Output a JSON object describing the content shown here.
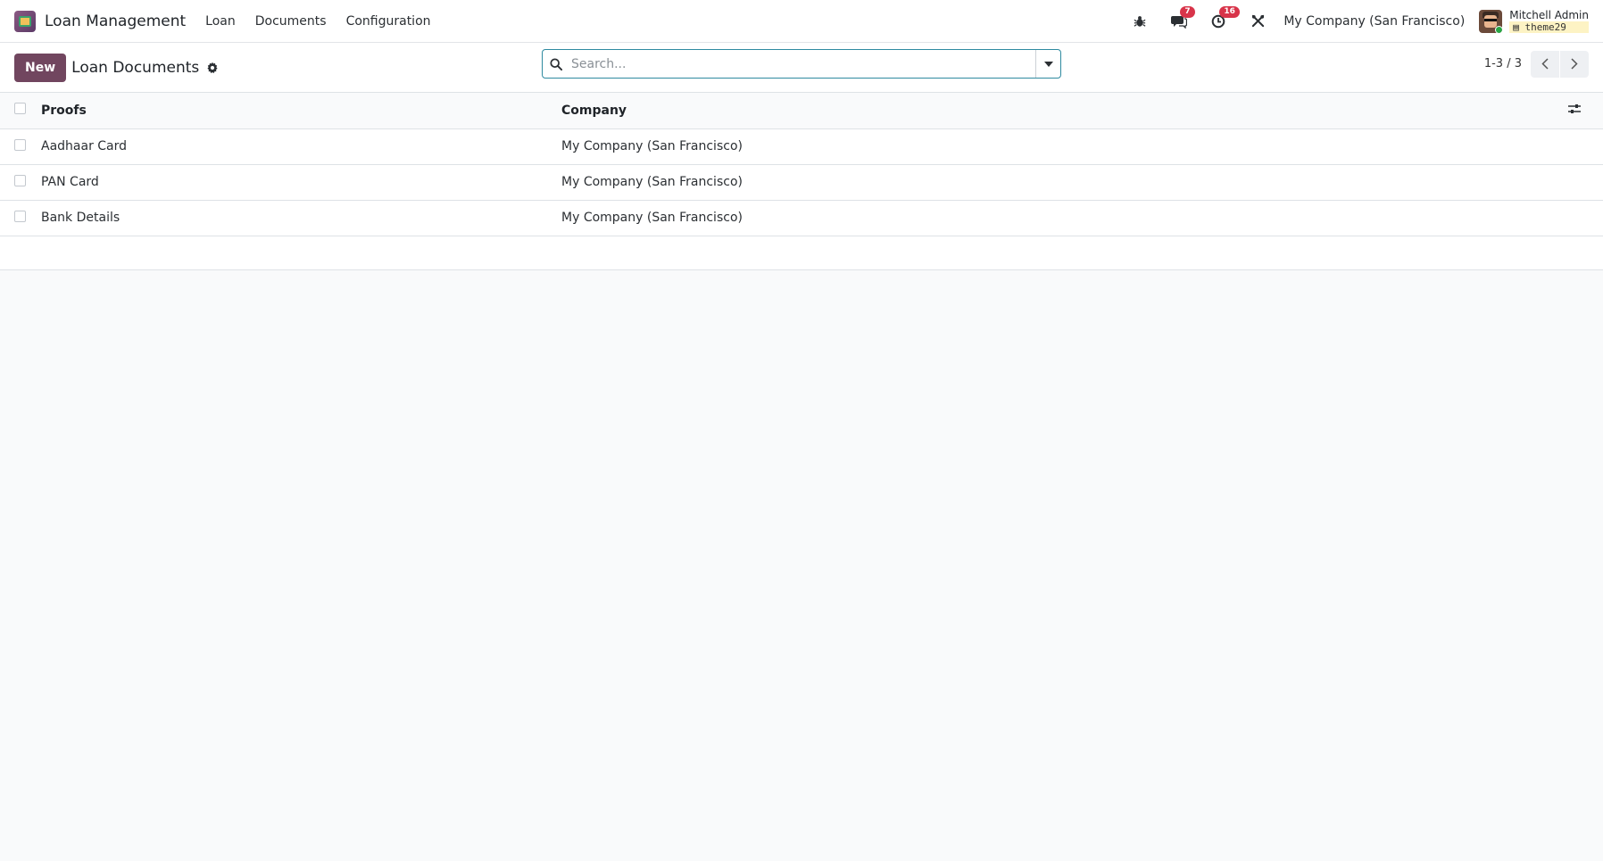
{
  "navbar": {
    "app_name": "Loan Management",
    "menu": [
      "Loan",
      "Documents",
      "Configuration"
    ],
    "messages_count": "7",
    "activities_count": "16",
    "company": "My Company (San Francisco)",
    "user_name": "Mitchell Admin",
    "database": "theme29"
  },
  "control_panel": {
    "new_label": "New",
    "title": "Loan Documents",
    "search_placeholder": "Search...",
    "pager": "1-3 / 3"
  },
  "table": {
    "columns": [
      "Proofs",
      "Company"
    ],
    "rows": [
      {
        "proof": "Aadhaar Card",
        "company": "My Company (San Francisco)"
      },
      {
        "proof": "PAN Card",
        "company": "My Company (San Francisco)"
      },
      {
        "proof": "Bank Details",
        "company": "My Company (San Francisco)"
      }
    ]
  },
  "colors": {
    "primary": "#71465f",
    "badge": "#d8344a",
    "search_border": "#2f8aa0"
  },
  "icons": [
    "bug-icon",
    "chat-icon",
    "clock-icon",
    "tools-icon",
    "gear-icon",
    "search-icon",
    "caret-down-icon",
    "chevron-left-icon",
    "chevron-right-icon",
    "column-settings-icon"
  ]
}
